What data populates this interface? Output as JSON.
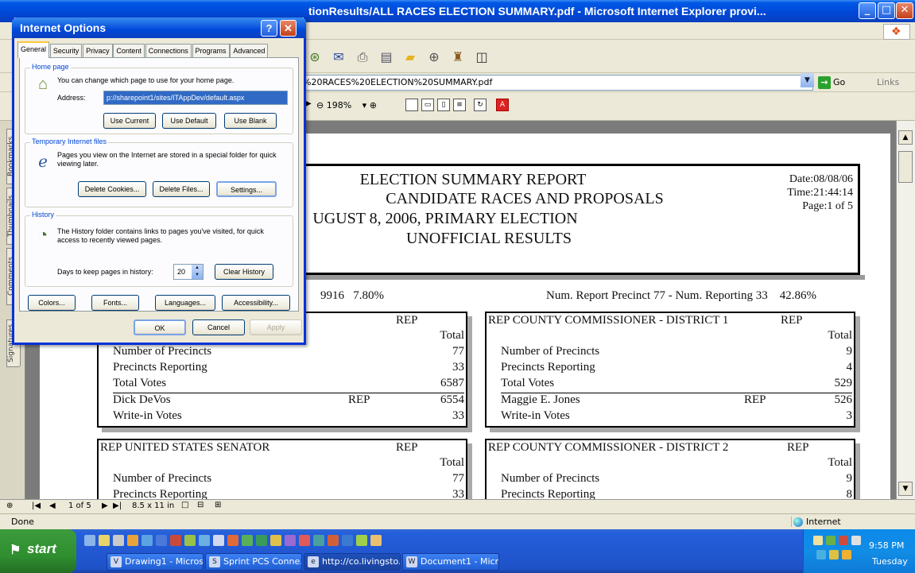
{
  "browser": {
    "title": "tionResults/ALL RACES ELECTION SUMMARY.pdf - Microsoft Internet Explorer provi...",
    "address_value": "%20RACES%20ELECTION%20SUMMARY.pdf",
    "go_label": "Go",
    "links_label": "Links",
    "status_text": "Done",
    "zone_text": "Internet"
  },
  "pdf_viewer": {
    "zoom": "198%",
    "page_indicator": "1 of 5",
    "page_size": "8.5 x 11 in"
  },
  "nav_tabs": [
    "Signatures",
    "Comments",
    "Thumbnails",
    "Bookmarks"
  ],
  "report": {
    "title": "ELECTION SUMMARY REPORT",
    "subtitle1": "CANDIDATE RACES AND PROPOSALS",
    "subtitle2": "UGUST 8, 2006, PRIMARY ELECTION",
    "subtitle3": "UNOFFICIAL RESULTS",
    "date": "Date:08/08/06",
    "time": "Time:21:44:14",
    "page": "Page:1 of 5",
    "summary_left": "9916   7.80%",
    "summary_right": "Num. Report Precinct 77 - Num. Reporting 33    42.86%",
    "total_label": "Total",
    "races": [
      {
        "title": "",
        "party": "REP",
        "rows": [
          {
            "label": "Number of Precincts",
            "party": "",
            "value": "77"
          },
          {
            "label": "Precincts Reporting",
            "party": "",
            "value": "33"
          },
          {
            "label": "Total Votes",
            "party": "",
            "value": "6587"
          },
          {
            "label": "Dick DeVos",
            "party": "REP",
            "value": "6554"
          },
          {
            "label": "Write-in Votes",
            "party": "",
            "value": "33"
          }
        ]
      },
      {
        "title": "REP COUNTY COMMISSIONER - DISTRICT 1",
        "party": "REP",
        "rows": [
          {
            "label": "Number of Precincts",
            "party": "",
            "value": "9"
          },
          {
            "label": "Precincts Reporting",
            "party": "",
            "value": "4"
          },
          {
            "label": "Total Votes",
            "party": "",
            "value": "529"
          },
          {
            "label": "Maggie E. Jones",
            "party": "REP",
            "value": "526"
          },
          {
            "label": "Write-in Votes",
            "party": "",
            "value": "3"
          }
        ]
      },
      {
        "title": "REP UNITED STATES SENATOR",
        "party": "REP",
        "rows": [
          {
            "label": "Number of Precincts",
            "party": "",
            "value": "77"
          },
          {
            "label": "Precincts Reporting",
            "party": "",
            "value": "33"
          }
        ]
      },
      {
        "title": "REP COUNTY COMMISSIONER - DISTRICT 2",
        "party": "REP",
        "rows": [
          {
            "label": "Number of Precincts",
            "party": "",
            "value": "9"
          },
          {
            "label": "Precincts Reporting",
            "party": "",
            "value": "8"
          }
        ]
      }
    ]
  },
  "dialog": {
    "title": "Internet Options",
    "tabs": [
      "General",
      "Security",
      "Privacy",
      "Content",
      "Connections",
      "Programs",
      "Advanced"
    ],
    "home_page": {
      "label": "Home page",
      "description": "You can change which page to use for your home page.",
      "address_label": "Address:",
      "address_value": "p://sharepoint1/sites/ITAppDev/default.aspx",
      "buttons": [
        "Use Current",
        "Use Default",
        "Use Blank"
      ]
    },
    "temp_files": {
      "label": "Temporary Internet files",
      "description": "Pages you view on the Internet are stored in a special folder for quick viewing later.",
      "buttons": [
        "Delete Cookies...",
        "Delete Files...",
        "Settings..."
      ]
    },
    "history": {
      "label": "History",
      "description": "The History folder contains links to pages you've visited, for quick access to recently viewed pages.",
      "days_label": "Days to keep pages in history:",
      "days_value": "20",
      "clear_button": "Clear History"
    },
    "bottom_buttons": [
      "Colors...",
      "Fonts...",
      "Languages...",
      "Accessibility..."
    ],
    "ok": "OK",
    "cancel": "Cancel",
    "apply": "Apply"
  },
  "taskbar": {
    "start": "start",
    "tasks": [
      "Drawing1 - Micros...",
      "Sprint PCS Conne...",
      "http://co.livingsto...",
      "Document1 - Micr..."
    ],
    "time": "9:58 PM",
    "day": "Tuesday"
  }
}
